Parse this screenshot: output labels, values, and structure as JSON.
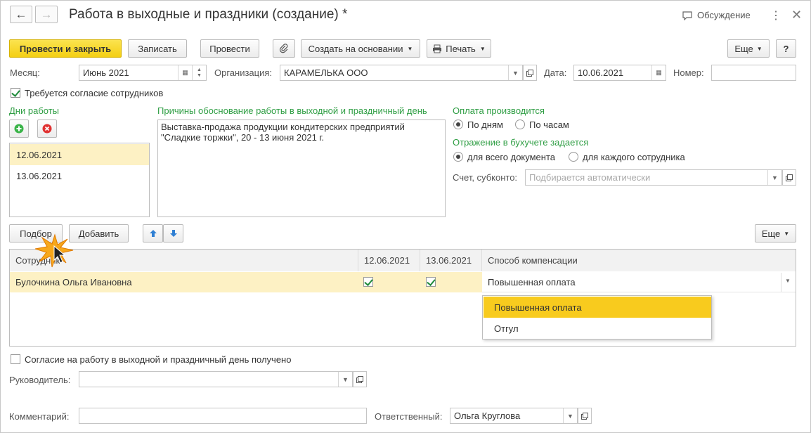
{
  "window": {
    "title": "Работа в выходные и праздники (создание) *",
    "discuss_label": "Обсуждение",
    "more_icon": "more-vertical-icon",
    "close_icon": "close-icon"
  },
  "toolbar": {
    "post_close": "Провести и закрыть",
    "save": "Записать",
    "post": "Провести",
    "create_based": "Создать на основании",
    "print": "Печать",
    "more": "Еще",
    "help": "?"
  },
  "header": {
    "month_label": "Месяц:",
    "month_value": "Июнь 2021",
    "org_label": "Организация:",
    "org_value": "КАРАМЕЛЬКА ООО",
    "date_label": "Дата:",
    "date_value": "10.06.2021",
    "number_label": "Номер:",
    "number_value": ""
  },
  "consent_required_label": "Требуется согласие сотрудников",
  "workdays": {
    "title": "Дни работы",
    "items": [
      "12.06.2021",
      "13.06.2021"
    ]
  },
  "reasons": {
    "title": "Причины обоснование работы в выходной и праздничный день",
    "line1": "Выставка-продажа продукции кондитерских предприятий",
    "line2": "\"Сладкие торжки\", 20 - 13 июня 2021 г."
  },
  "payment": {
    "title": "Оплата производится",
    "by_days": "По дням",
    "by_hours": "По часам"
  },
  "accounting": {
    "title": "Отражение в бухучете задается",
    "whole_doc": "для всего документа",
    "each_employee": "для каждого сотрудника",
    "account_label": "Счет, субконто:",
    "account_placeholder": "Подбирается автоматически"
  },
  "table_toolbar": {
    "pick": "Подбор",
    "add": "Добавить",
    "more": "Еще"
  },
  "table": {
    "headers": [
      "Сотрудник",
      "12.06.2021",
      "13.06.2021",
      "Способ компенсации"
    ],
    "rows": [
      {
        "employee": "Булочкина Ольга Ивановна",
        "d1": true,
        "d2": true,
        "compensation": "Повышенная оплата"
      }
    ]
  },
  "dropdown": {
    "options": [
      "Повышенная оплата",
      "Отгул"
    ],
    "selected": "Повышенная оплата"
  },
  "footer": {
    "consent_received_label": "Согласие на работу в выходной и праздничный день получено",
    "manager_label": "Руководитель:",
    "manager_value": "",
    "comment_label": "Комментарий:",
    "comment_value": "",
    "responsible_label": "Ответственный:",
    "responsible_value": "Ольга Круглова"
  },
  "colors": {
    "accent_yellow": "#f4cf13",
    "selected_row": "#fdf1c4",
    "section_green": "#2f9e44"
  }
}
